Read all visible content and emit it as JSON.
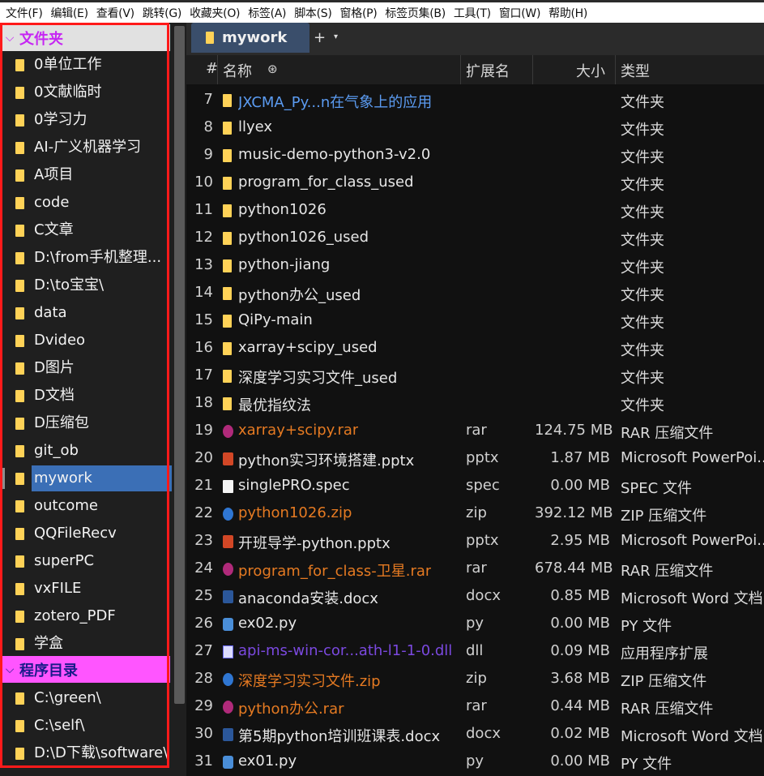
{
  "menu": [
    "文件(F)",
    "编辑(E)",
    "查看(V)",
    "跳转(G)",
    "收藏夹(O)",
    "标签(A)",
    "脚本(S)",
    "窗格(P)",
    "标签页集(B)",
    "工具(T)",
    "窗口(W)",
    "帮助(H)"
  ],
  "sidebar": {
    "section1": "文件夹",
    "folders": [
      "0单位工作",
      "0文献临时",
      "0学习力",
      "AI-广义机器学习",
      "A项目",
      "code",
      "C文章",
      "D:\\from手机整理...",
      "D:\\to宝宝\\",
      "data",
      "Dvideo",
      "D图片",
      "D文档",
      "D压缩包",
      "git_ob",
      "mywork",
      "outcome",
      "QQFileRecv",
      "superPC",
      "vxFILE",
      "zotero_PDF",
      "学盒"
    ],
    "active_index": 15,
    "section2": "程序目录",
    "programs": [
      "C:\\green\\",
      "C:\\self\\",
      "D:\\D下载\\software\\"
    ]
  },
  "tabs": {
    "active": "mywork",
    "add": "+",
    "menu": "▾"
  },
  "header": {
    "num": "#",
    "name": "名称",
    "ext": "扩展名",
    "size": "大小",
    "type": "类型"
  },
  "rows": [
    {
      "n": "7",
      "name": "JXCMA_Py...n在气象上的应用",
      "ext": "",
      "size": "",
      "type": "文件夹",
      "icon": "folder",
      "color": "blue"
    },
    {
      "n": "8",
      "name": "llyex",
      "ext": "",
      "size": "",
      "type": "文件夹",
      "icon": "folder",
      "color": ""
    },
    {
      "n": "9",
      "name": "music-demo-python3-v2.0",
      "ext": "",
      "size": "",
      "type": "文件夹",
      "icon": "folder",
      "color": ""
    },
    {
      "n": "10",
      "name": "program_for_class_used",
      "ext": "",
      "size": "",
      "type": "文件夹",
      "icon": "folder",
      "color": ""
    },
    {
      "n": "11",
      "name": "python1026",
      "ext": "",
      "size": "",
      "type": "文件夹",
      "icon": "folder",
      "color": ""
    },
    {
      "n": "12",
      "name": "python1026_used",
      "ext": "",
      "size": "",
      "type": "文件夹",
      "icon": "folder",
      "color": ""
    },
    {
      "n": "13",
      "name": "python-jiang",
      "ext": "",
      "size": "",
      "type": "文件夹",
      "icon": "folder",
      "color": ""
    },
    {
      "n": "14",
      "name": "python办公_used",
      "ext": "",
      "size": "",
      "type": "文件夹",
      "icon": "folder",
      "color": ""
    },
    {
      "n": "15",
      "name": "QiPy-main",
      "ext": "",
      "size": "",
      "type": "文件夹",
      "icon": "folder",
      "color": ""
    },
    {
      "n": "16",
      "name": "xarray+scipy_used",
      "ext": "",
      "size": "",
      "type": "文件夹",
      "icon": "folder",
      "color": ""
    },
    {
      "n": "17",
      "name": "深度学习实习文件_used",
      "ext": "",
      "size": "",
      "type": "文件夹",
      "icon": "folder",
      "color": ""
    },
    {
      "n": "18",
      "name": "最优指纹法",
      "ext": "",
      "size": "",
      "type": "文件夹",
      "icon": "folder",
      "color": ""
    },
    {
      "n": "19",
      "name": "xarray+scipy.rar",
      "ext": "rar",
      "size": "124.75 MB",
      "type": "RAR 压缩文件",
      "icon": "rar",
      "color": "orange"
    },
    {
      "n": "20",
      "name": "python实习环境搭建.pptx",
      "ext": "pptx",
      "size": "1.87 MB",
      "type": "Microsoft PowerPoi...",
      "icon": "ppt",
      "color": ""
    },
    {
      "n": "21",
      "name": "singlePRO.spec",
      "ext": "spec",
      "size": "0.00 MB",
      "type": "SPEC 文件",
      "icon": "doc",
      "color": ""
    },
    {
      "n": "22",
      "name": "python1026.zip",
      "ext": "zip",
      "size": "392.12 MB",
      "type": "ZIP 压缩文件",
      "icon": "zip",
      "color": "orange"
    },
    {
      "n": "23",
      "name": "开班导学-python.pptx",
      "ext": "pptx",
      "size": "2.95 MB",
      "type": "Microsoft PowerPoi...",
      "icon": "ppt",
      "color": ""
    },
    {
      "n": "24",
      "name": "program_for_class-卫星.rar",
      "ext": "rar",
      "size": "678.44 MB",
      "type": "RAR 压缩文件",
      "icon": "rar",
      "color": "orange"
    },
    {
      "n": "25",
      "name": "anaconda安装.docx",
      "ext": "docx",
      "size": "0.85 MB",
      "type": "Microsoft Word 文档",
      "icon": "word",
      "color": ""
    },
    {
      "n": "26",
      "name": "ex02.py",
      "ext": "py",
      "size": "0.00 MB",
      "type": "PY 文件",
      "icon": "py",
      "color": ""
    },
    {
      "n": "27",
      "name": "api-ms-win-cor...ath-l1-1-0.dll",
      "ext": "dll",
      "size": "0.09 MB",
      "type": "应用程序扩展",
      "icon": "dll",
      "color": "purple"
    },
    {
      "n": "28",
      "name": "深度学习实习文件.zip",
      "ext": "zip",
      "size": "3.68 MB",
      "type": "ZIP 压缩文件",
      "icon": "zip",
      "color": "orange"
    },
    {
      "n": "29",
      "name": "python办公.rar",
      "ext": "rar",
      "size": "0.44 MB",
      "type": "RAR 压缩文件",
      "icon": "rar",
      "color": "orange"
    },
    {
      "n": "30",
      "name": "第5期python培训班课表.docx",
      "ext": "docx",
      "size": "0.02 MB",
      "type": "Microsoft Word 文档",
      "icon": "word",
      "color": ""
    },
    {
      "n": "31",
      "name": "ex01.py",
      "ext": "py",
      "size": "0.00 MB",
      "type": "PY 文件",
      "icon": "py",
      "color": ""
    }
  ]
}
